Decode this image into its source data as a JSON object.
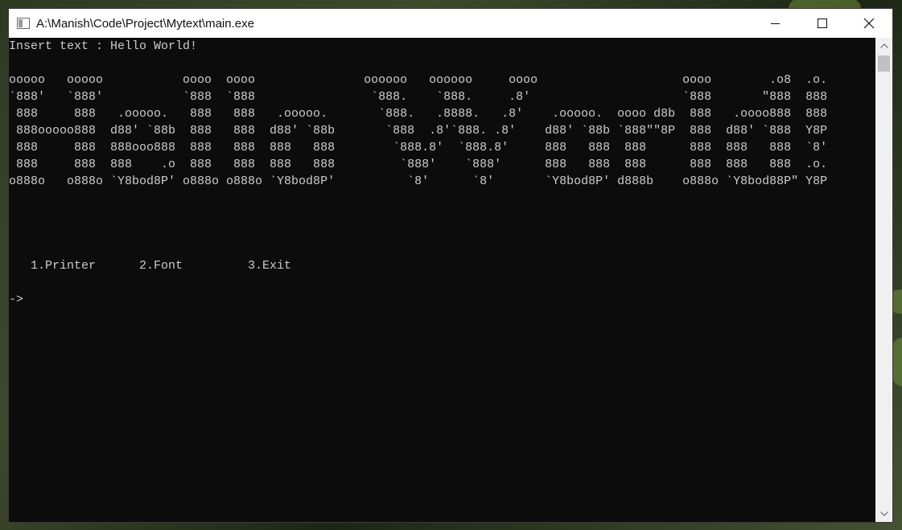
{
  "window": {
    "title": "A:\\Manish\\Code\\Project\\Mytext\\main.exe"
  },
  "icons": {
    "app": "console-app-icon",
    "minimize": "minimize-icon",
    "maximize": "maximize-icon",
    "close": "close-icon",
    "scroll_up": "chevron-up-icon",
    "scroll_down": "chevron-down-icon"
  },
  "console": {
    "prompt_line": "Insert text : Hello World!",
    "ascii_art": [
      "ooooo   ooooo           oooo  oooo               oooooo   oooooo     oooo                    oooo        .o8  .o.",
      "`888'   `888'           `888  `888                `888.    `888.     .8'                     `888       \"888  888",
      " 888     888   .ooooo.   888   888   .ooooo.       `888.   .8888.   .8'    .ooooo.  oooo d8b  888   .oooo888  888",
      " 888ooooo888  d88' `88b  888   888  d88' `88b       `888  .8'`888. .8'    d88' `88b `888\"\"8P  888  d88' `888  Y8P",
      " 888     888  888ooo888  888   888  888   888        `888.8'  `888.8'     888   888  888      888  888   888  `8'",
      " 888     888  888    .o  888   888  888   888         `888'    `888'      888   888  888      888  888   888  .o.",
      "o888o   o888o `Y8bod8P' o888o o888o `Y8bod8P'          `8'      `8'       `Y8bod8P' d888b    o888o `Y8bod88P\" Y8P"
    ],
    "menu_line": "   1.Printer      2.Font         3.Exit",
    "cursor_prompt": "->"
  },
  "colors": {
    "console_bg": "#0c0c0c",
    "console_fg": "#cccccc",
    "titlebar_bg": "#ffffff"
  }
}
